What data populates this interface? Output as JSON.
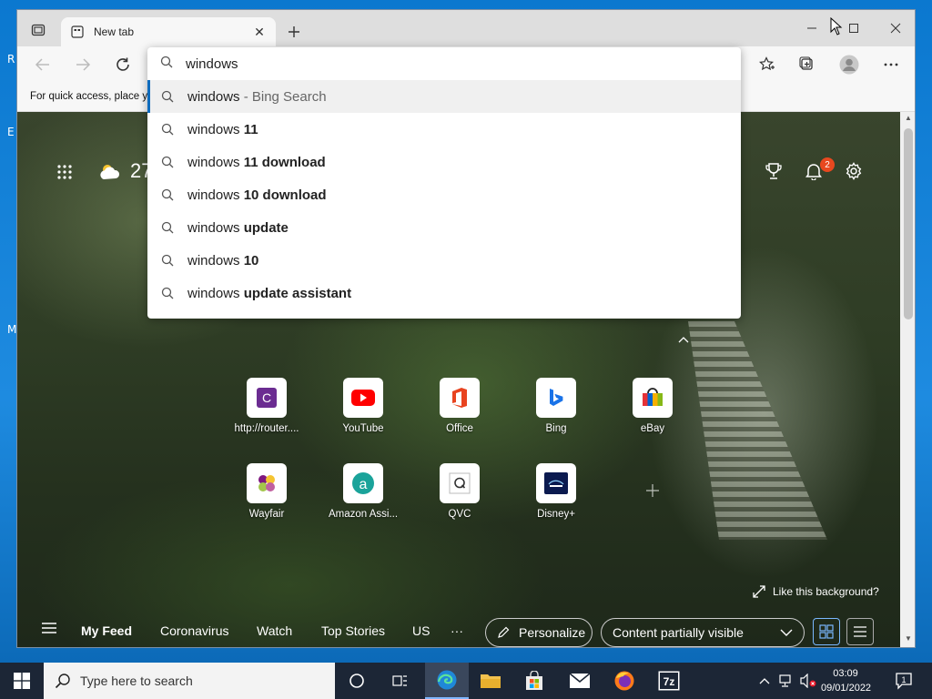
{
  "desktop": {
    "marks": [
      "R",
      "E",
      "M"
    ]
  },
  "browser": {
    "tab_title": "New tab",
    "favorites_hint": "For quick access, place y"
  },
  "omnibox": {
    "query": "windows",
    "suggestions": [
      {
        "prefix": "windows",
        "bold": "",
        "hint": " - Bing Search",
        "selected": true
      },
      {
        "prefix": "windows ",
        "bold": "11",
        "hint": ""
      },
      {
        "prefix": "windows ",
        "bold": "11 download",
        "hint": ""
      },
      {
        "prefix": "windows ",
        "bold": "10 download",
        "hint": ""
      },
      {
        "prefix": "windows ",
        "bold": "update",
        "hint": ""
      },
      {
        "prefix": "windows ",
        "bold": "10",
        "hint": ""
      },
      {
        "prefix": "windows ",
        "bold": "update assistant",
        "hint": ""
      }
    ]
  },
  "ntp": {
    "weather_temp": "27",
    "notifications_count": "2",
    "tiles": [
      {
        "label": "http://router....",
        "icon": "router-c-icon"
      },
      {
        "label": "YouTube",
        "icon": "youtube-icon"
      },
      {
        "label": "Office",
        "icon": "office-icon"
      },
      {
        "label": "Bing",
        "icon": "bing-icon"
      },
      {
        "label": "eBay",
        "icon": "ebay-icon"
      },
      {
        "label": "Wayfair",
        "icon": "wayfair-icon"
      },
      {
        "label": "Amazon Assi...",
        "icon": "amazon-assistant-icon"
      },
      {
        "label": "QVC",
        "icon": "qvc-icon"
      },
      {
        "label": "Disney+",
        "icon": "disney-plus-icon"
      }
    ],
    "like_bg": "Like this background?",
    "feed_tabs": [
      "My Feed",
      "Coronavirus",
      "Watch",
      "Top Stories",
      "US",
      "···"
    ],
    "personalize": "Personalize",
    "visibility": "Content partially visible"
  },
  "taskbar": {
    "search_placeholder": "Type here to search",
    "time": "03:09",
    "date": "09/01/2022",
    "notification_count": "1"
  },
  "colors": {
    "accent": "#0f6cbd",
    "taskbar": "#1c2636",
    "badge": "#e8481f"
  }
}
